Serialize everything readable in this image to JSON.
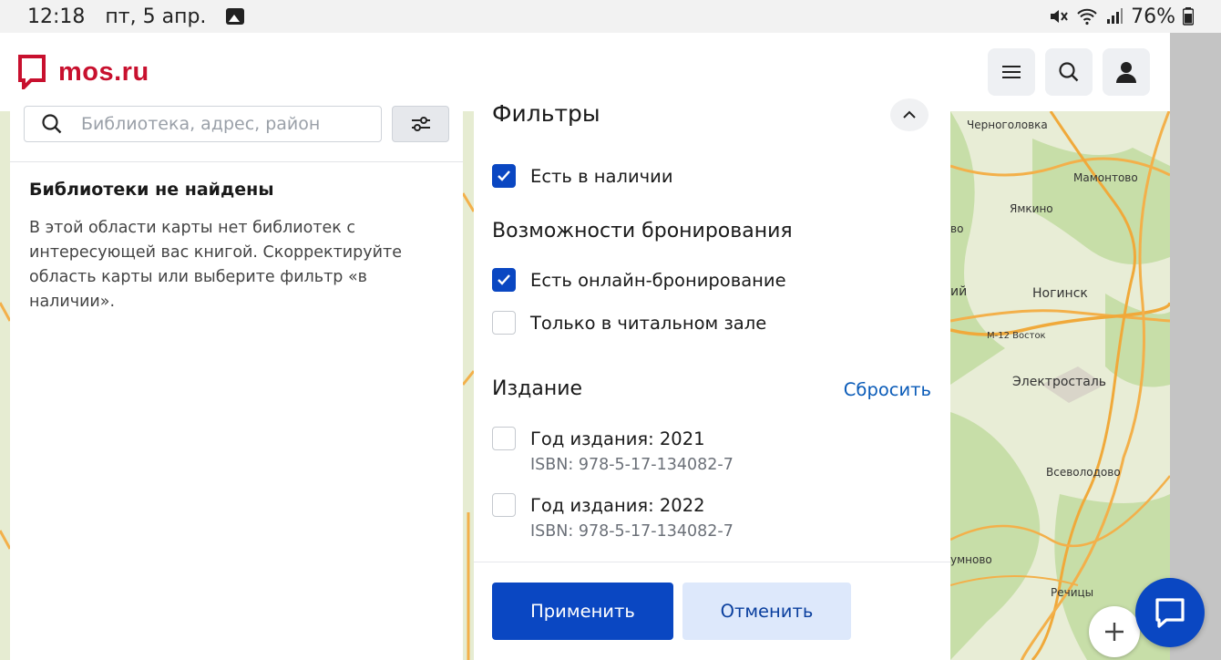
{
  "status_bar": {
    "time": "12:18",
    "date": "пт, 5 апр.",
    "battery": "76%",
    "icons": [
      "gallery-icon",
      "mute-icon",
      "wifi-icon",
      "signal-icon",
      "battery-icon"
    ]
  },
  "header": {
    "logo_text": "mos.ru",
    "brand_color": "#c8102e",
    "buttons": [
      "menu-icon",
      "search-icon",
      "user-icon"
    ]
  },
  "search": {
    "placeholder": "Библиотека, адрес, район"
  },
  "results": {
    "title": "Библиотеки не найдены",
    "message": "В этой области карты нет библиотек с интересующей вас книгой. Скорректируйте область карты или выберите фильтр «в наличии»."
  },
  "filters": {
    "title": "Фильтры",
    "availability": {
      "label": "Есть в наличии",
      "checked": true
    },
    "booking_section": "Возможности бронирования",
    "booking_options": [
      {
        "label": "Есть онлайн-бронирование",
        "checked": true
      },
      {
        "label": "Только в читальном зале",
        "checked": false
      }
    ],
    "edition_section": "Издание",
    "reset_label": "Сбросить",
    "editions": [
      {
        "label": "Год издания: 2021",
        "isbn": "ISBN: 978-5-17-134082-7",
        "checked": false
      },
      {
        "label": "Год издания: 2022",
        "isbn": "ISBN: 978-5-17-134082-7",
        "checked": false
      }
    ],
    "apply_label": "Применить",
    "cancel_label": "Отменить",
    "accent_color": "#0a47c2"
  },
  "map": {
    "labels": {
      "chernogolovka": "Черноголовка",
      "mamontovo": "Мамонтово",
      "yamkino": "Ямкино",
      "noginsk": "Ногинск",
      "m12": "М-12 Восток",
      "elektrostal": "Электросталь",
      "vsevolodovo": "Всеволодово",
      "rechitsy": "Речицы",
      "umnovo": "умново",
      "bo_top": "во",
      "bo_left": "ий"
    }
  }
}
